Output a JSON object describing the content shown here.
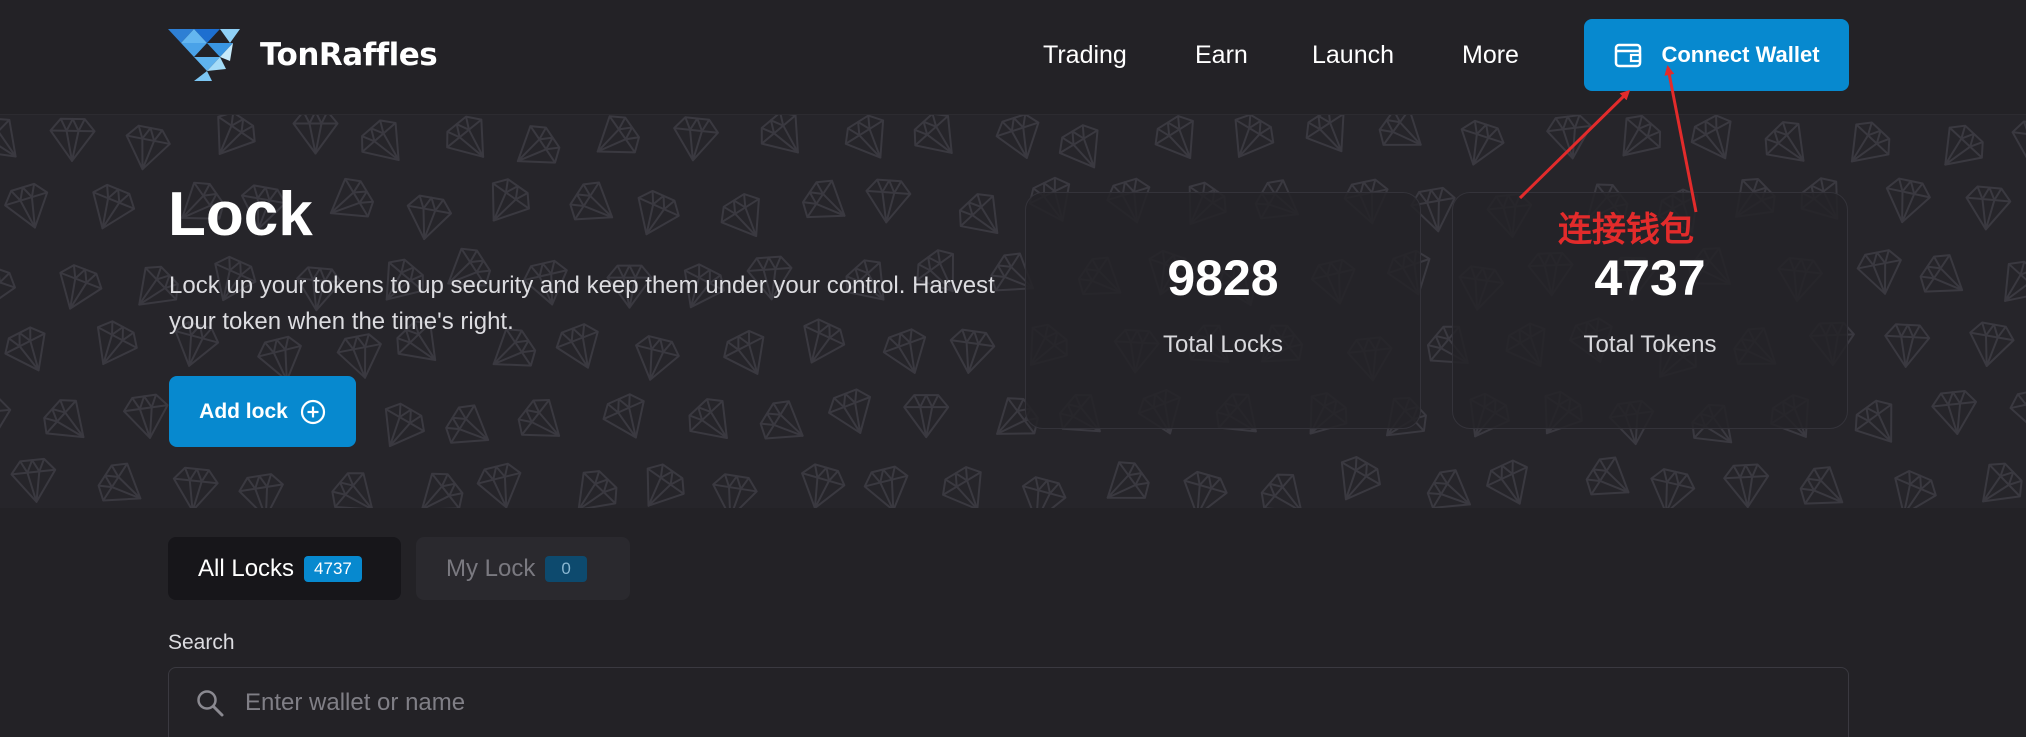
{
  "app": {
    "brand": "TonRaffles"
  },
  "nav": {
    "items": [
      {
        "label": "Trading"
      },
      {
        "label": "Earn"
      },
      {
        "label": "Launch"
      },
      {
        "label": "More"
      }
    ],
    "connect_label": "Connect Wallet"
  },
  "hero": {
    "title": "Lock",
    "description": "Lock up your tokens to up security and keep them under your control. Harvest your token when the time's right.",
    "add_lock_label": "Add lock",
    "stats": [
      {
        "value": "9828",
        "label": "Total Locks"
      },
      {
        "value": "4737",
        "label": "Total Tokens"
      }
    ]
  },
  "annotation": {
    "text": "连接钱包"
  },
  "tabs": [
    {
      "label": "All Locks",
      "badge": "4737",
      "active": true
    },
    {
      "label": "My Lock",
      "badge": "0",
      "active": false
    }
  ],
  "search": {
    "label": "Search",
    "placeholder": "Enter wallet or name",
    "value": ""
  },
  "colors": {
    "accent": "#0789cf",
    "background": "#232226",
    "annotation": "#e22b2b"
  },
  "icons": [
    "logo-mark-icon",
    "wallet-icon",
    "plus-circle-icon",
    "search-icon",
    "diamond-pattern"
  ]
}
